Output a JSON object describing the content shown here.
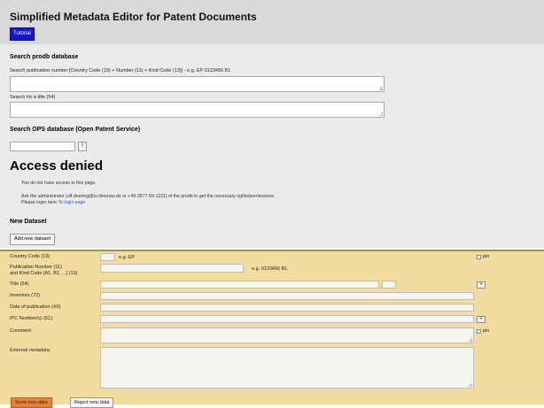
{
  "header": {
    "title_prefix": "Simplified Metadata Editor for",
    "title_strong": "Patent Documents",
    "tutorial_label": "Tutorial"
  },
  "prodb": {
    "heading": "Search prodb database",
    "pub_label": "Search publication number [Country Code (19) + Number (11) + Kind Code (13)] - e.g. EP 0123456 B1",
    "title_label": "Search for a title (54)"
  },
  "ops": {
    "heading": "Search OPS database (Open Patent Service)",
    "button_label": "!"
  },
  "access": {
    "title": "Access denied",
    "line1": "You do not have access to this page.",
    "line2": "Ask the administrator (ulf.doering@tu-ilmenau.de or +49-3677-69-1211) of the prodb to get the necessary rights/permissions.",
    "line3_prefix": "Please login here",
    "line3_link": "To login page"
  },
  "dataset": {
    "heading": "New Dataset",
    "add_label": "Add new dataset"
  },
  "form": {
    "country_label": "Country Code (19)",
    "country_hint": "e.g. EP",
    "pub_label1": "Publication Number (11)",
    "pub_label2": "and Kind Code [A1, B1, ...] (13)",
    "pub_hint": "e.g. 0123456 B1",
    "title_label": "Title (54)",
    "inventors_label": "Inventors (72)",
    "date_label": "Date of publication (4X)",
    "ipc_label": "IPC Number(s) (51):",
    "comment_label": "Comment:",
    "external_label": "External metadata:",
    "pin_label": "pin",
    "plus_label": "+",
    "send_label": "Send new data",
    "reject_label": "Reject new data"
  }
}
